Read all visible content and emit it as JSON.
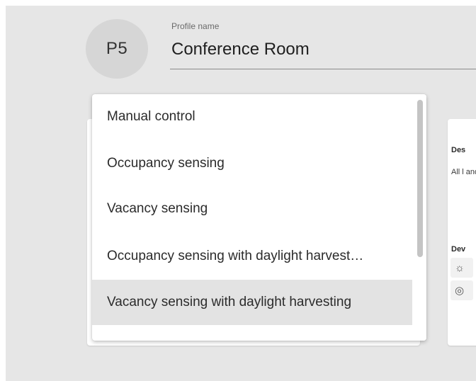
{
  "profile": {
    "avatar_text": "P5",
    "name_label": "Profile name",
    "name_value": "Conference Room"
  },
  "dropdown": {
    "options": [
      {
        "label": "Manual control",
        "selected": false
      },
      {
        "label": "Occupancy sensing",
        "selected": false
      },
      {
        "label": "Vacancy sensing",
        "selected": false
      },
      {
        "label": "Occupancy sensing with daylight harvest…",
        "selected": false
      },
      {
        "label": "Vacancy sensing with daylight harvesting",
        "selected": true
      }
    ]
  },
  "details": {
    "description_title": "Des",
    "description_text": "All l and auto suff",
    "devices_title": "Dev",
    "device_icons": [
      "light-bulb-icon",
      "sensor-icon"
    ]
  },
  "colors": {
    "page_bg": "#e6e6e6",
    "selected_bg": "#e3e3e3",
    "avatar_bg": "#d6d6d6"
  }
}
